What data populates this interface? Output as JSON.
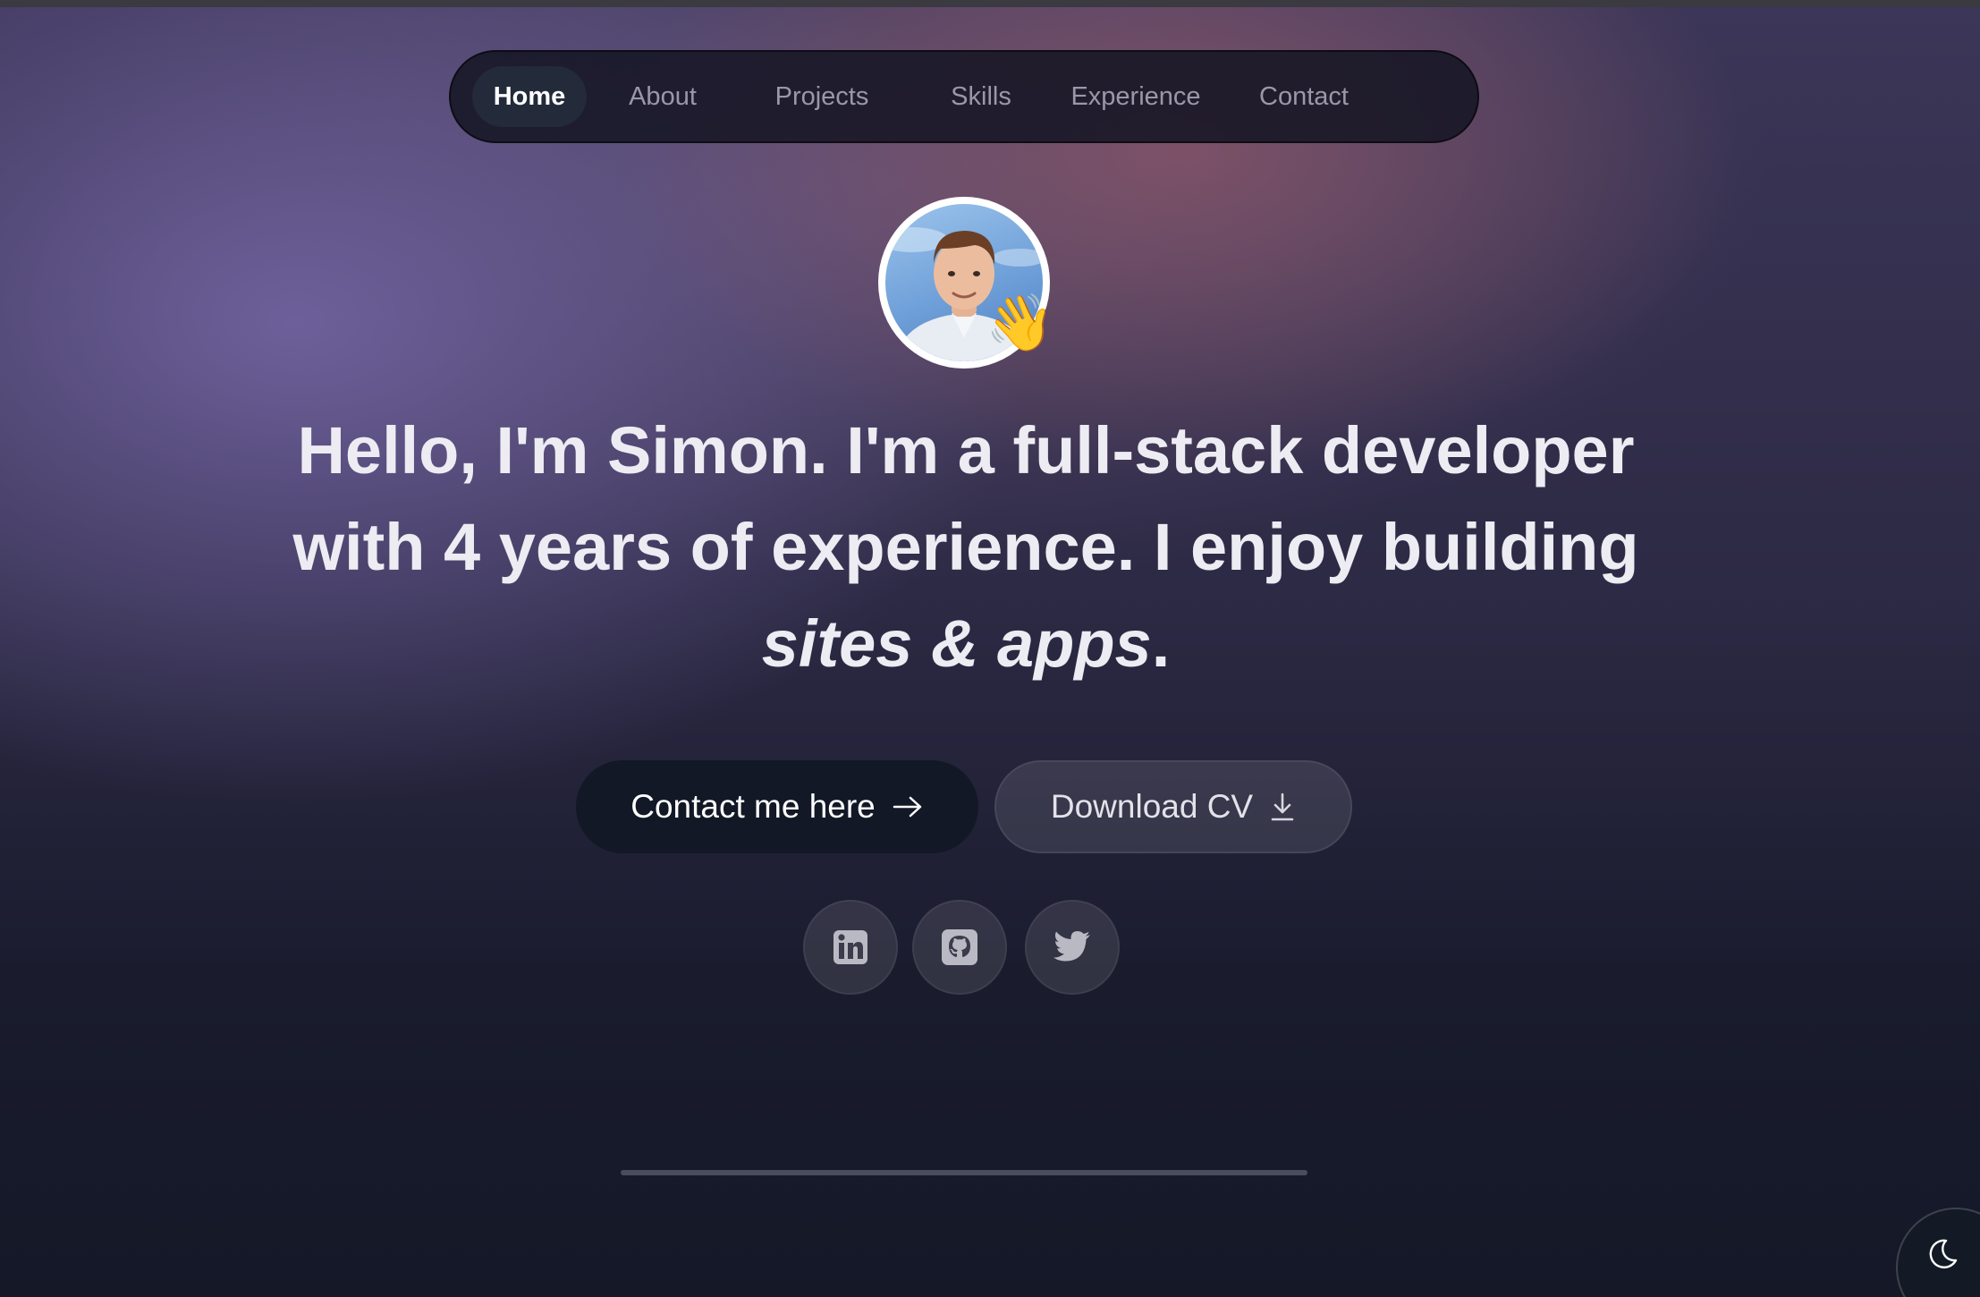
{
  "nav": {
    "items": [
      {
        "label": "Home",
        "active": true
      },
      {
        "label": "About"
      },
      {
        "label": "Projects"
      },
      {
        "label": "Skills"
      },
      {
        "label": "Experience"
      },
      {
        "label": "Contact"
      }
    ]
  },
  "hero": {
    "avatar_emoji": "👋",
    "headline": {
      "greeting": "Hello, I'm Simon.",
      "role_prefix": " I'm a ",
      "role": "full-stack developer",
      "exp_prefix": "with ",
      "years": "4 years",
      "exp_suffix": " of experience. I enjoy building",
      "focus": "sites & apps",
      "end": "."
    }
  },
  "actions": {
    "contact_label": "Contact me here",
    "cv_label": "Download CV"
  },
  "social": {
    "icons": [
      "linkedin-icon",
      "github-icon",
      "twitter-icon"
    ]
  },
  "theme_toggle": {
    "icon": "moon-icon"
  },
  "colors": {
    "button_dark": "#121826",
    "text_light": "#ececf2",
    "nav_active_bg": "#232a3a"
  }
}
